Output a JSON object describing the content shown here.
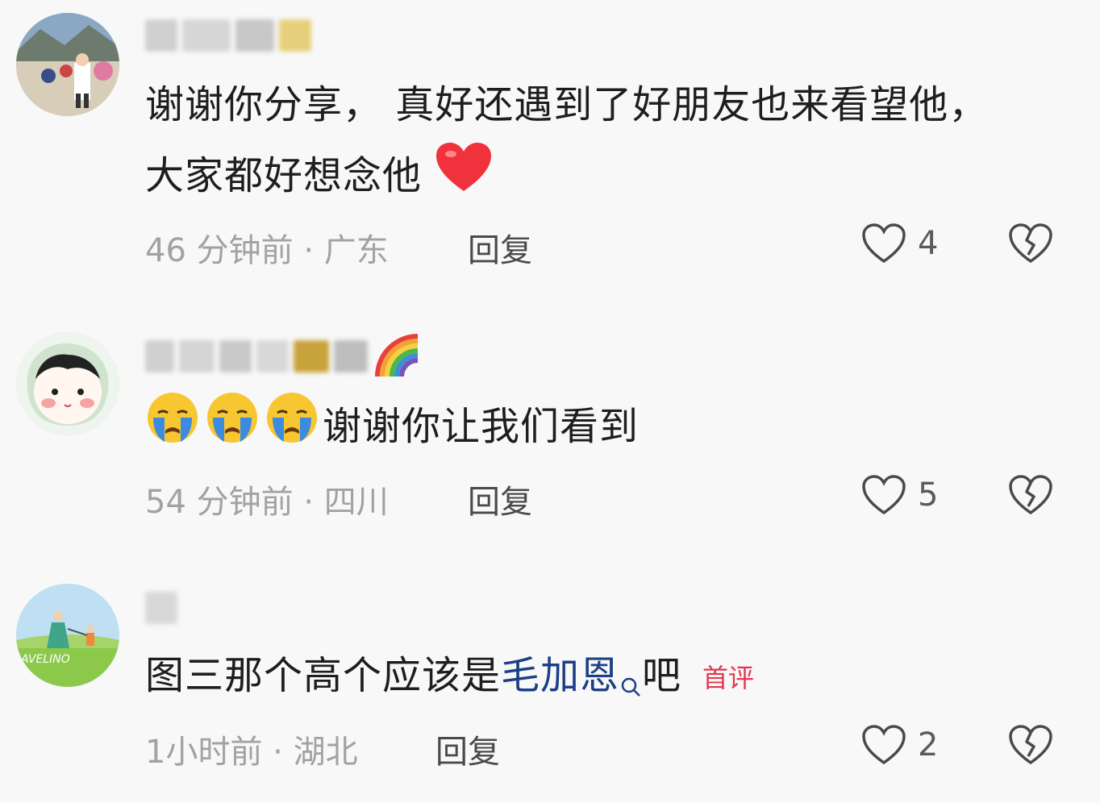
{
  "comments": [
    {
      "text": "谢谢你分享， 真好还遇到了好朋友也来看望他，大家都好想念他",
      "time": "46 分钟前",
      "location": "广东",
      "reply_label": "回复",
      "likes": "4",
      "emoji_icon": "red-heart-icon"
    },
    {
      "text": "谢谢你让我们看到",
      "time": "54 分钟前",
      "location": "四川",
      "reply_label": "回复",
      "likes": "5",
      "emoji_icon": "crying-face-icon"
    },
    {
      "text_before": "图三那个高个应该是",
      "link_text": "毛加恩",
      "text_after": "吧",
      "tag": "首评",
      "time": "1小时前",
      "location": "湖北",
      "reply_label": "回复",
      "likes": "2"
    }
  ],
  "colors": {
    "background": "#f8f8f8",
    "meta_text": "#a2a2a2",
    "link": "#1d3f86",
    "tag": "#e03850"
  }
}
